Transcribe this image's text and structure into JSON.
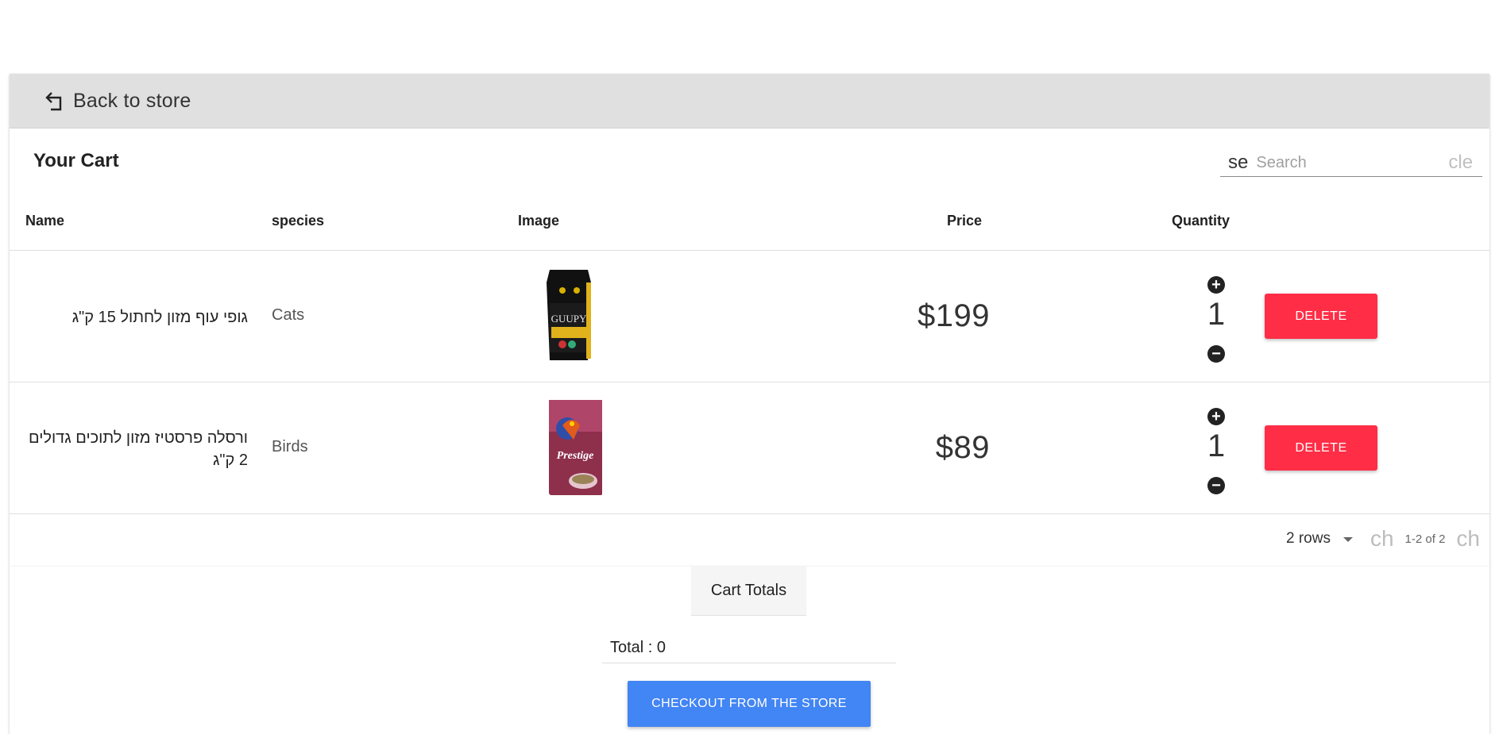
{
  "nav": {
    "back_label": "Back to store",
    "back_icon": "return-arrow-icon"
  },
  "cart": {
    "title": "Your Cart",
    "search": {
      "icon_text": "se",
      "placeholder": "Search",
      "value": "",
      "clear_text": "cle"
    },
    "columns": {
      "name": "Name",
      "species": "species",
      "image": "Image",
      "price": "Price",
      "quantity": "Quantity"
    },
    "rows": [
      {
        "name": "גופי עוף מזון לחתול 15 ק\"ג",
        "species": "Cats",
        "image_label": "GUUPY",
        "price": "$199",
        "quantity": "1",
        "delete_label": "DELETE"
      },
      {
        "name": "ורסלה פרסטיז מזון לתוכים גדולים 2 ק\"ג",
        "species": "Birds",
        "image_label": "Prestige",
        "price": "$89",
        "quantity": "1",
        "delete_label": "DELETE"
      }
    ],
    "pagination": {
      "rows_per_page": "2 rows",
      "prev_text": "ch",
      "range": "1-2 of 2",
      "next_text": "ch"
    }
  },
  "totals": {
    "tab_label": "Cart Totals",
    "total_text": "Total : 0",
    "checkout_label": "CHECKOUT FROM THE STORE"
  },
  "colors": {
    "delete": "#ff2d46",
    "checkout": "#4285f4",
    "nav_bar": "#e0e0e0"
  }
}
